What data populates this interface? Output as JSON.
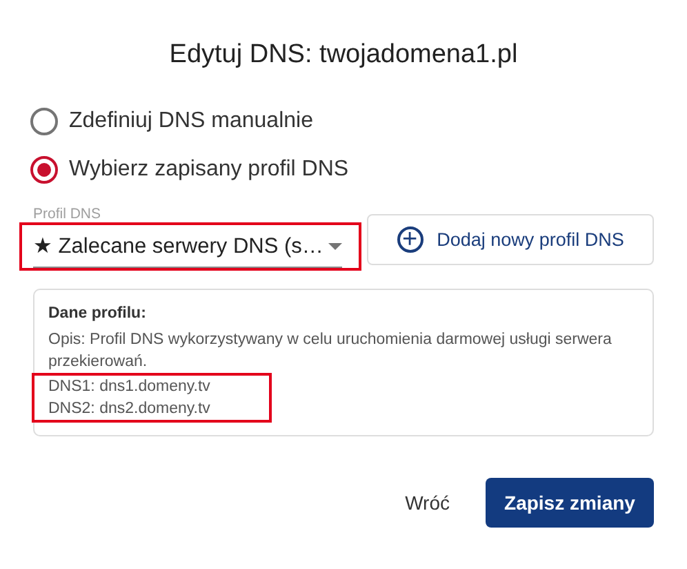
{
  "dialog": {
    "title": "Edytuj DNS: twojadomena1.pl"
  },
  "options": [
    {
      "label": "Zdefiniuj DNS manualnie",
      "selected": false
    },
    {
      "label": "Wybierz zapisany profil DNS",
      "selected": true
    }
  ],
  "profile_select": {
    "label": "Profil DNS",
    "value": "★ Zalecane serwery DNS (s…",
    "highlighted": true
  },
  "add_profile_button": {
    "icon": "+",
    "label": "Dodaj nowy profil DNS"
  },
  "profile_details": {
    "heading": "Dane profilu:",
    "description": "Opis: Profil DNS wykorzystywany w celu uruchomienia darmowej usługi serwera przekierowań.",
    "servers": [
      "DNS1: dns1.domeny.tv",
      "DNS2: dns2.domeny.tv"
    ],
    "servers_highlighted": true
  },
  "buttons": {
    "back": "Wróć",
    "save": "Zapisz zmiany"
  }
}
